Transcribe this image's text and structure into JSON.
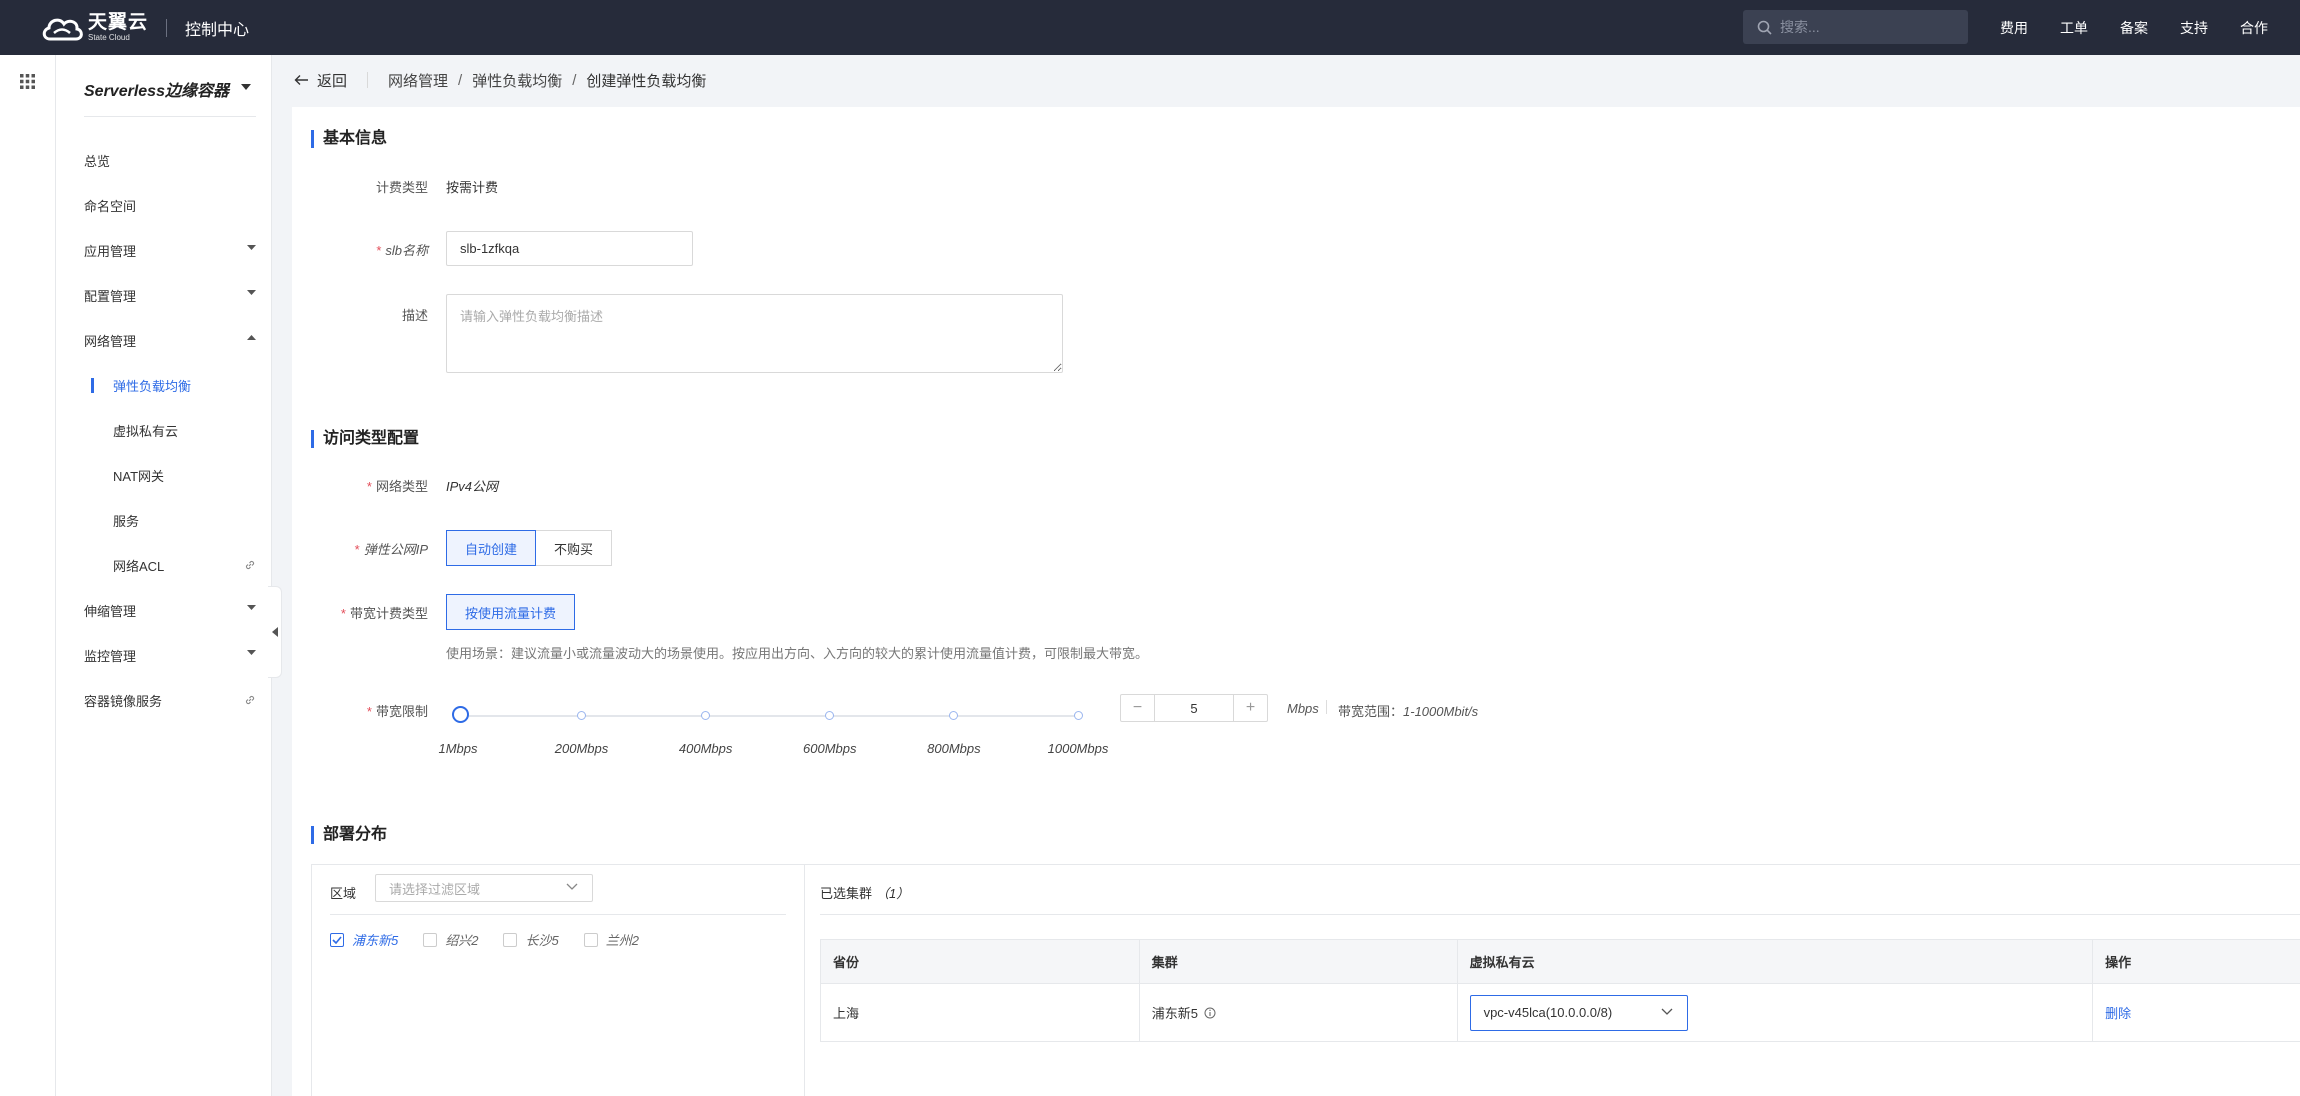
{
  "topbar": {
    "logo_cn": "天翼云",
    "logo_en": "State Cloud",
    "console_title": "控制中心",
    "search_placeholder": "搜索...",
    "nav": [
      "费用",
      "工单",
      "备案",
      "支持",
      "合作"
    ]
  },
  "sidebar": {
    "product_title": "Serverless边缘容器",
    "items": [
      {
        "label": "总览"
      },
      {
        "label": "命名空间"
      },
      {
        "label": "应用管理"
      },
      {
        "label": "配置管理"
      },
      {
        "label": "网络管理"
      },
      {
        "label": "弹性负载均衡"
      },
      {
        "label": "虚拟私有云"
      },
      {
        "label": "NAT网关"
      },
      {
        "label": "服务"
      },
      {
        "label": "网络ACL"
      },
      {
        "label": "伸缩管理"
      },
      {
        "label": "监控管理"
      },
      {
        "label": "容器镜像服务"
      }
    ]
  },
  "breadcrumb": {
    "back": "返回",
    "items": [
      "网络管理",
      "弹性负载均衡",
      "创建弹性负载均衡"
    ]
  },
  "basic": {
    "title": "基本信息",
    "billing_label": "计费类型",
    "billing_value": "按需计费",
    "name_label": "slb名称",
    "name_value": "slb-1zfkqa",
    "desc_label": "描述",
    "desc_placeholder": "请输入弹性负载均衡描述"
  },
  "access": {
    "title": "访问类型配置",
    "network_label": "网络类型",
    "network_value": "IPv4公网",
    "eip_label": "弹性公网IP",
    "eip_options": [
      "自动创建",
      "不购买"
    ],
    "eip_selected": "自动创建",
    "bw_billing_label": "带宽计费类型",
    "bw_billing_option": "按使用流量计费",
    "bw_hint": "使用场景：建议流量小或流量波动大的场景使用。按应用出方向、入方向的较大的累计使用流量值计费，可限制最大带宽。",
    "bw_limit_label": "带宽限制",
    "slider": {
      "min": 1,
      "max": 1000,
      "value": 5,
      "marks": [
        {
          "value": 1,
          "label": "1Mbps"
        },
        {
          "value": 200,
          "label": "200Mbps"
        },
        {
          "value": 400,
          "label": "400Mbps"
        },
        {
          "value": 600,
          "label": "600Mbps"
        },
        {
          "value": 800,
          "label": "800Mbps"
        },
        {
          "value": 1000,
          "label": "1000Mbps"
        }
      ]
    },
    "stepper_value": "5",
    "stepper_minus": "−",
    "stepper_plus": "+",
    "unit": "Mbps",
    "range_prefix": "带宽范围：",
    "range_value": "1-1000Mbit/s"
  },
  "deploy": {
    "title": "部署分布",
    "region_label": "区域",
    "region_placeholder": "请选择过滤区域",
    "regions": [
      {
        "label": "浦东新5",
        "checked": true
      },
      {
        "label": "绍兴2",
        "checked": false
      },
      {
        "label": "长沙5",
        "checked": false
      },
      {
        "label": "兰州2",
        "checked": false
      }
    ],
    "selected_title": "已选集群",
    "selected_count": "（1）",
    "table": {
      "headers": [
        "省份",
        "集群",
        "虚拟私有云",
        "操作"
      ],
      "rows": [
        {
          "province": "上海",
          "cluster": "浦东新5",
          "vpc": "vpc-v45lca(10.0.0.0/8)",
          "action": "删除"
        }
      ]
    }
  },
  "colors": {
    "accent": "#2e6be6",
    "topbar_bg": "#262b3a",
    "required": "#e34d59"
  }
}
